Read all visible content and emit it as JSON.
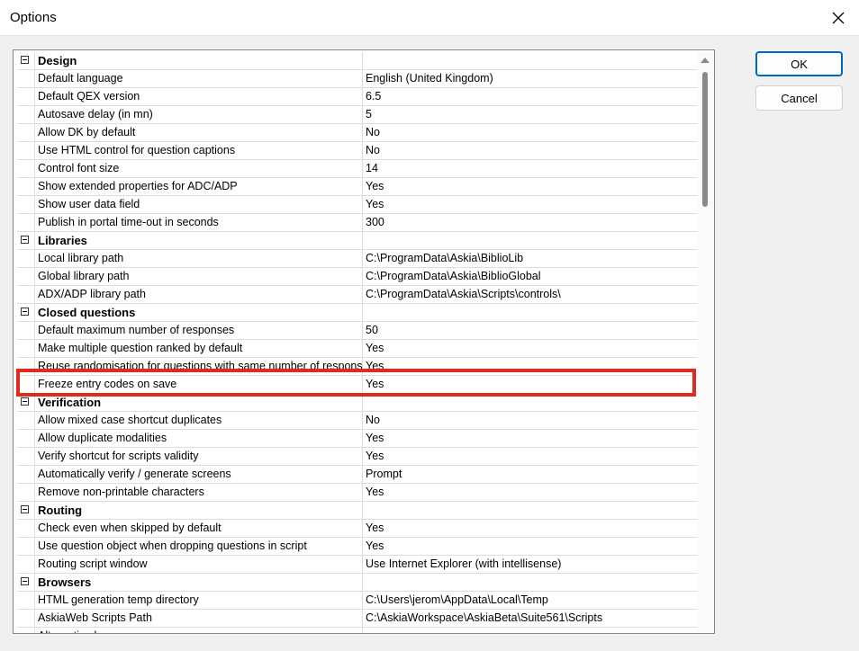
{
  "window": {
    "title": "Options"
  },
  "buttons": {
    "ok_label": "OK",
    "cancel_label": "Cancel"
  },
  "rows": [
    {
      "type": "category",
      "name": "Design",
      "value": ""
    },
    {
      "type": "prop",
      "name": "Default language",
      "value": "English (United Kingdom)"
    },
    {
      "type": "prop",
      "name": "Default QEX version",
      "value": "6.5"
    },
    {
      "type": "prop",
      "name": "Autosave delay (in mn)",
      "value": "5"
    },
    {
      "type": "prop",
      "name": "Allow DK by default",
      "value": "No"
    },
    {
      "type": "prop",
      "name": "Use HTML control for question captions",
      "value": "No"
    },
    {
      "type": "prop",
      "name": "Control font size",
      "value": "14"
    },
    {
      "type": "prop",
      "name": "Show extended properties for ADC/ADP",
      "value": "Yes"
    },
    {
      "type": "prop",
      "name": "Show user data field",
      "value": "Yes"
    },
    {
      "type": "prop",
      "name": "Publish in portal time-out in seconds",
      "value": "300"
    },
    {
      "type": "category",
      "name": "Libraries",
      "value": ""
    },
    {
      "type": "prop",
      "name": "Local library path",
      "value": "C:\\ProgramData\\Askia\\BiblioLib"
    },
    {
      "type": "prop",
      "name": "Global library path",
      "value": "C:\\ProgramData\\Askia\\BiblioGlobal"
    },
    {
      "type": "prop",
      "name": "ADX/ADP library path",
      "value": "C:\\ProgramData\\Askia\\Scripts\\controls\\"
    },
    {
      "type": "category",
      "name": "Closed questions",
      "value": ""
    },
    {
      "type": "prop",
      "name": "Default maximum number of responses",
      "value": "50"
    },
    {
      "type": "prop",
      "name": "Make multiple question ranked by default",
      "value": "Yes"
    },
    {
      "type": "prop",
      "name": "Reuse randomisation for questions with same number of responses",
      "value": "Yes"
    },
    {
      "type": "prop",
      "name": "Freeze entry codes on save",
      "value": "Yes"
    },
    {
      "type": "category",
      "name": "Verification",
      "value": ""
    },
    {
      "type": "prop",
      "name": "Allow mixed case shortcut duplicates",
      "value": "No"
    },
    {
      "type": "prop",
      "name": "Allow duplicate modalities",
      "value": "Yes"
    },
    {
      "type": "prop",
      "name": "Verify shortcut for scripts validity",
      "value": "Yes"
    },
    {
      "type": "prop",
      "name": "Automatically verify / generate screens",
      "value": "Prompt"
    },
    {
      "type": "prop",
      "name": "Remove non-printable characters",
      "value": "Yes"
    },
    {
      "type": "category",
      "name": "Routing",
      "value": ""
    },
    {
      "type": "prop",
      "name": "Check even when skipped by default",
      "value": "Yes"
    },
    {
      "type": "prop",
      "name": "Use question object when dropping questions in script",
      "value": "Yes"
    },
    {
      "type": "prop",
      "name": "Routing script window",
      "value": "Use Internet Explorer (with intellisense)"
    },
    {
      "type": "category",
      "name": "Browsers",
      "value": ""
    },
    {
      "type": "prop",
      "name": "HTML generation temp directory",
      "value": "C:\\Users\\jerom\\AppData\\Local\\Temp"
    },
    {
      "type": "prop",
      "name": "AskiaWeb Scripts Path",
      "value": "C:\\AskiaWorkspace\\AskiaBeta\\Suite561\\Scripts"
    },
    {
      "type": "prop",
      "name": "Alternative browser",
      "value": ""
    }
  ],
  "highlighted_row": "Freeze entry codes on save",
  "colors": {
    "highlight": "#e02a1f",
    "accent": "#0067c0"
  },
  "icons": {
    "close": "close-icon",
    "expander": "collapse-minus-icon"
  }
}
